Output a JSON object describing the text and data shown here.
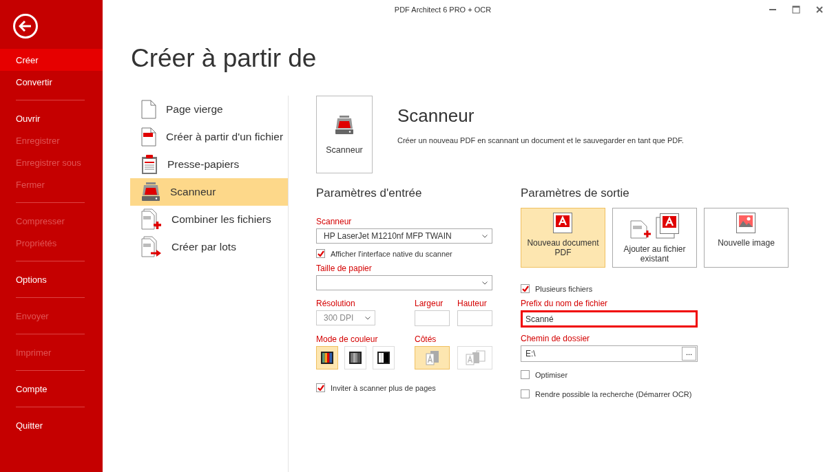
{
  "window": {
    "title": "PDF Architect 6 PRO + OCR"
  },
  "sidebar": {
    "groups": [
      {
        "items": [
          {
            "label": "Créer",
            "selected": true,
            "disabled": false
          },
          {
            "label": "Convertir",
            "selected": false,
            "disabled": false
          }
        ]
      },
      {
        "items": [
          {
            "label": "Ouvrir",
            "selected": false,
            "disabled": false
          },
          {
            "label": "Enregistrer",
            "selected": false,
            "disabled": true
          },
          {
            "label": "Enregistrer sous",
            "selected": false,
            "disabled": true
          },
          {
            "label": "Fermer",
            "selected": false,
            "disabled": true
          }
        ]
      },
      {
        "items": [
          {
            "label": "Compresser",
            "selected": false,
            "disabled": true
          },
          {
            "label": "Propriétés",
            "selected": false,
            "disabled": true
          }
        ]
      },
      {
        "items": [
          {
            "label": "Options",
            "selected": false,
            "disabled": false
          }
        ]
      },
      {
        "items": [
          {
            "label": "Envoyer",
            "selected": false,
            "disabled": true
          }
        ]
      },
      {
        "items": [
          {
            "label": "Imprimer",
            "selected": false,
            "disabled": true
          }
        ]
      },
      {
        "items": [
          {
            "label": "Compte",
            "selected": false,
            "disabled": false
          }
        ]
      },
      {
        "items": [
          {
            "label": "Quitter",
            "selected": false,
            "disabled": false
          }
        ]
      }
    ]
  },
  "page_title": "Créer à partir de",
  "sources": [
    {
      "label": "Page vierge",
      "kind": "blank",
      "selected": false
    },
    {
      "label": "Créer à partir d'un fichier",
      "kind": "file",
      "selected": false
    },
    {
      "label": "Presse-papiers",
      "kind": "clipboard",
      "selected": false
    },
    {
      "label": "Scanneur",
      "kind": "scanner",
      "selected": true
    },
    {
      "label": "Combiner les fichiers",
      "kind": "combine",
      "selected": false
    },
    {
      "label": "Créer par lots",
      "kind": "batch",
      "selected": false
    }
  ],
  "detail": {
    "tile_label": "Scanneur",
    "heading": "Scanneur",
    "description": "Créer un nouveau PDF en scannant un document et le sauvegarder en tant que PDF."
  },
  "input": {
    "heading": "Paramètres d'entrée",
    "scanner": {
      "label": "Scanneur",
      "value": "HP LaserJet M1210nf MFP TWAIN"
    },
    "native_ui": {
      "label": "Afficher l'interface native du scanner",
      "checked": true
    },
    "paper": {
      "label": "Taille de papier"
    },
    "resolution": {
      "label": "Résolution",
      "value": "300 DPI",
      "disabled": true
    },
    "width": {
      "label": "Largeur"
    },
    "height": {
      "label": "Hauteur"
    },
    "color_mode": {
      "label": "Mode de couleur",
      "options": [
        {
          "kind": "color",
          "selected": true
        },
        {
          "kind": "gray",
          "selected": false
        },
        {
          "kind": "bw",
          "selected": false
        }
      ]
    },
    "sides": {
      "label": "Côtés",
      "options": [
        {
          "kind": "single",
          "selected": true
        },
        {
          "kind": "double",
          "selected": false
        }
      ]
    },
    "more_pages": {
      "label": "Inviter à scanner plus de pages",
      "checked": true
    }
  },
  "output": {
    "heading": "Paramètres de sortie",
    "targets": [
      {
        "label": "Nouveau document PDF",
        "kind": "new_pdf",
        "selected": true
      },
      {
        "label": "Ajouter au fichier existant",
        "kind": "append",
        "selected": false
      },
      {
        "label": "Nouvelle image",
        "kind": "image",
        "selected": false
      }
    ],
    "multiple_files": {
      "label": "Plusieurs fichiers",
      "checked": true
    },
    "prefix": {
      "label": "Prefix du nom de fichier",
      "value": "Scanné",
      "focused": true
    },
    "folder": {
      "label": "Chemin de dossier",
      "value": "E:\\",
      "browse": "..."
    },
    "optimize": {
      "label": "Optimiser",
      "checked": false
    },
    "ocr": {
      "label": "Rendre possible la recherche (Démarrer OCR)",
      "checked": false
    }
  }
}
